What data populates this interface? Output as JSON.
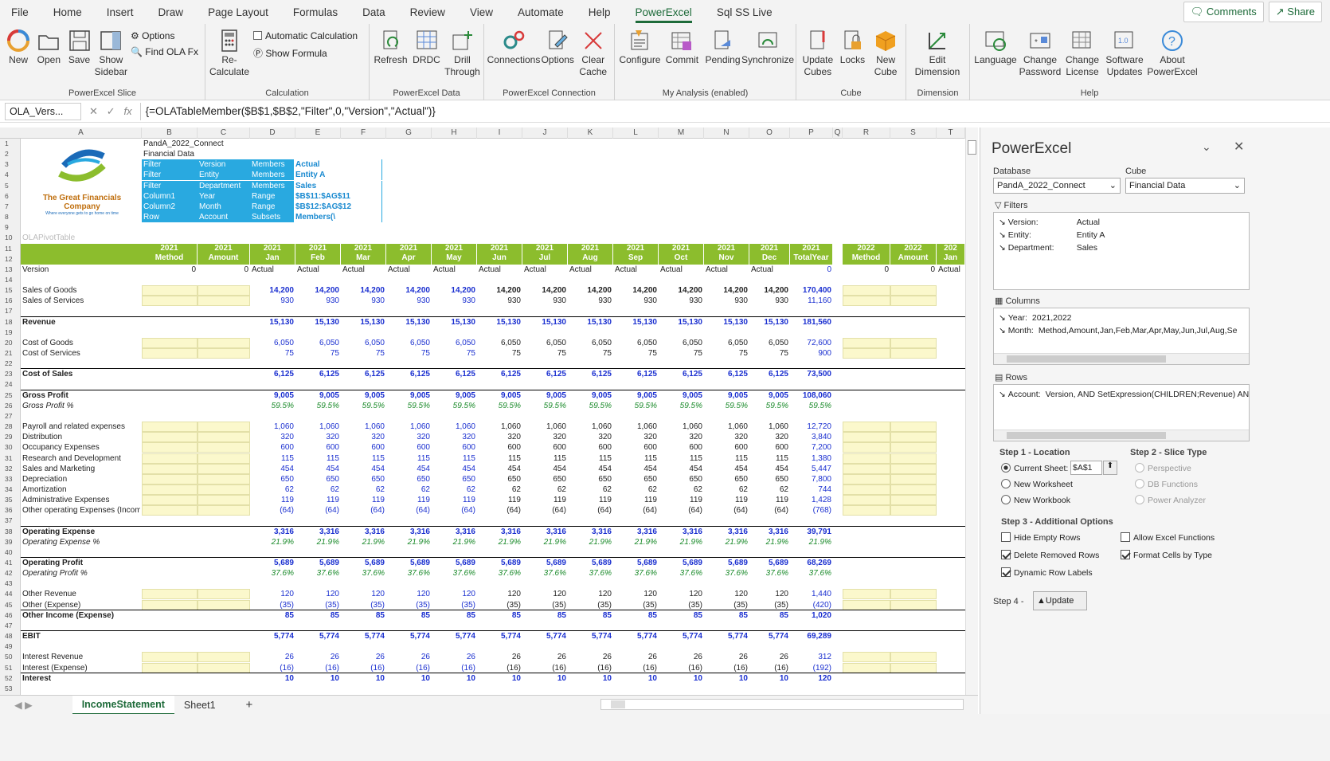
{
  "menu": {
    "items": [
      "File",
      "Home",
      "Insert",
      "Draw",
      "Page Layout",
      "Formulas",
      "Data",
      "Review",
      "View",
      "Automate",
      "Help",
      "PowerExcel",
      "Sql SS Live"
    ],
    "active": "PowerExcel",
    "comments": "Comments",
    "share": "Share"
  },
  "ribbon": {
    "slice": {
      "label": "PowerExcel Slice",
      "new": "New",
      "open": "Open",
      "save": "Save",
      "show_sidebar": "Show Sidebar",
      "options": "Options",
      "find": "Find OLA Fx"
    },
    "calc": {
      "label": "Calculation",
      "recalc": "Re-Calculate",
      "auto": "Automatic Calculation",
      "show_formula": "Show Formula"
    },
    "data": {
      "label": "PowerExcel Data",
      "refresh": "Refresh",
      "drdc": "DRDC",
      "drill": "Drill Through"
    },
    "conn": {
      "label": "PowerExcel Connection",
      "connections": "Connections",
      "options": "Options",
      "clear": "Clear Cache"
    },
    "analysis": {
      "label": "My Analysis (enabled)",
      "configure": "Configure",
      "commit": "Commit",
      "pending": "Pending",
      "sync": "Synchronize"
    },
    "cube": {
      "label": "Cube",
      "update": "Update Cubes",
      "locks": "Locks",
      "new": "New Cube"
    },
    "dimension": {
      "label": "Dimension",
      "edit": "Edit Dimension"
    },
    "help": {
      "label": "Help",
      "language": "Language",
      "change_pw": "Change Password",
      "change_lic": "Change License",
      "sw_updates": "Software Updates",
      "about": "About PowerExcel"
    }
  },
  "formula_bar": {
    "name_box": "OLA_Vers...",
    "fx": "fx",
    "formula": "{=OLATableMember($B$1,$B$2,\"Filter\",0,\"Version\",\"Actual\")}"
  },
  "columns": [
    "A",
    "B",
    "C",
    "D",
    "E",
    "F",
    "G",
    "H",
    "I",
    "J",
    "K",
    "L",
    "M",
    "N",
    "O",
    "P",
    "Q",
    "R",
    "S",
    "T"
  ],
  "logo": {
    "line1": "The Great Financials",
    "line2": "Company",
    "tagline": "Where everyone gets to go home on time"
  },
  "header_block": {
    "b1": "PandA_2022_Connect",
    "b2": "Financial Data",
    "rows": [
      {
        "c1": "Filter",
        "c2": "Version",
        "c3": "Members",
        "c4": "Actual"
      },
      {
        "c1": "Filter",
        "c2": "Entity",
        "c3": "Members",
        "c4": "Entity A"
      },
      {
        "c1": "Filter",
        "c2": "Department",
        "c3": "Members",
        "c4": "Sales"
      },
      {
        "c1": "Column1",
        "c2": "Year",
        "c3": "Range",
        "c4": "$B$11:$AG$11"
      },
      {
        "c1": "Column2",
        "c2": "Month",
        "c3": "Range",
        "c4": "$B$12:$AG$12"
      },
      {
        "c1": "Row",
        "c2": "Account",
        "c3": "Subsets",
        "c4": "Members(\\"
      }
    ],
    "pivot_label": "OLAPivotTable"
  },
  "col_headers": [
    {
      "y": "2021",
      "m": "Method"
    },
    {
      "y": "2021",
      "m": "Amount"
    },
    {
      "y": "2021",
      "m": "Jan"
    },
    {
      "y": "2021",
      "m": "Feb"
    },
    {
      "y": "2021",
      "m": "Mar"
    },
    {
      "y": "2021",
      "m": "Apr"
    },
    {
      "y": "2021",
      "m": "May"
    },
    {
      "y": "2021",
      "m": "Jun"
    },
    {
      "y": "2021",
      "m": "Jul"
    },
    {
      "y": "2021",
      "m": "Aug"
    },
    {
      "y": "2021",
      "m": "Sep"
    },
    {
      "y": "2021",
      "m": "Oct"
    },
    {
      "y": "2021",
      "m": "Nov"
    },
    {
      "y": "2021",
      "m": "Dec"
    },
    {
      "y": "2021",
      "m": "TotalYear"
    },
    {
      "y": "2022",
      "m": "Method"
    },
    {
      "y": "2022",
      "m": "Amount"
    },
    {
      "y": "202",
      "m": "Jan"
    }
  ],
  "version_row": {
    "label": "Version",
    "b": "0",
    "c": "0",
    "month": "Actual",
    "total": "0",
    "r": "0",
    "s": "0",
    "t": "Actual"
  },
  "rows": [
    {
      "r": 15,
      "label": "Sales of Goods",
      "v": "14,200",
      "t": "170,400",
      "style": "bold",
      "yellow": true
    },
    {
      "r": 16,
      "label": "Sales of Services",
      "v": "930",
      "t": "11,160",
      "style": "",
      "yellow": true
    },
    {
      "r": 18,
      "label": "Revenue",
      "v": "15,130",
      "t": "181,560",
      "style": "total"
    },
    {
      "r": 20,
      "label": "Cost of Goods",
      "v": "6,050",
      "t": "72,600",
      "style": "",
      "yellow": true
    },
    {
      "r": 21,
      "label": "Cost of Services",
      "v": "75",
      "t": "900",
      "style": "",
      "yellow": true
    },
    {
      "r": 23,
      "label": "Cost of Sales",
      "v": "6,125",
      "t": "73,500",
      "style": "total"
    },
    {
      "r": 25,
      "label": "Gross Profit",
      "v": "9,005",
      "t": "108,060",
      "style": "total"
    },
    {
      "r": 26,
      "label": "Gross Profit %",
      "v": "59.5%",
      "t": "59.5%",
      "style": "pct"
    },
    {
      "r": 28,
      "label": "Payroll and related expenses",
      "v": "1,060",
      "t": "12,720",
      "style": "",
      "yellow": true
    },
    {
      "r": 29,
      "label": "Distribution",
      "v": "320",
      "t": "3,840",
      "style": "",
      "yellow": true
    },
    {
      "r": 30,
      "label": "Occupancy Expenses",
      "v": "600",
      "t": "7,200",
      "style": "",
      "yellow": true
    },
    {
      "r": 31,
      "label": "Research and Development",
      "v": "115",
      "t": "1,380",
      "style": "",
      "yellow": true
    },
    {
      "r": 32,
      "label": "Sales and Marketing",
      "v": "454",
      "t": "5,447",
      "style": "",
      "yellow": true
    },
    {
      "r": 33,
      "label": "Depreciation",
      "v": "650",
      "t": "7,800",
      "style": "",
      "yellow": true
    },
    {
      "r": 34,
      "label": "Amortization",
      "v": "62",
      "t": "744",
      "style": "",
      "yellow": true
    },
    {
      "r": 35,
      "label": "Administrative Expenses",
      "v": "119",
      "t": "1,428",
      "style": "",
      "yellow": true
    },
    {
      "r": 36,
      "label": "Other operating Expenses (Income",
      "v": "(64)",
      "t": "(768)",
      "style": "",
      "yellow": true
    },
    {
      "r": 38,
      "label": "Operating Expense",
      "v": "3,316",
      "t": "39,791",
      "style": "total"
    },
    {
      "r": 39,
      "label": "Operating Expense %",
      "v": "21.9%",
      "t": "21.9%",
      "style": "pct"
    },
    {
      "r": 41,
      "label": "Operating Profit",
      "v": "5,689",
      "t": "68,269",
      "style": "total"
    },
    {
      "r": 42,
      "label": "Operating Profit %",
      "v": "37.6%",
      "t": "37.6%",
      "style": "pct"
    },
    {
      "r": 44,
      "label": "Other Revenue",
      "v": "120",
      "t": "1,440",
      "style": "",
      "yellow": true
    },
    {
      "r": 45,
      "label": "Other (Expense)",
      "v": "(35)",
      "t": "(420)",
      "style": "",
      "yellow": true
    },
    {
      "r": 46,
      "label": "Other Income (Expense)",
      "v": "85",
      "t": "1,020",
      "style": "total"
    },
    {
      "r": 48,
      "label": "EBIT",
      "v": "5,774",
      "t": "69,289",
      "style": "total"
    },
    {
      "r": 50,
      "label": "Interest Revenue",
      "v": "26",
      "t": "312",
      "style": "",
      "yellow": true
    },
    {
      "r": 51,
      "label": "Interest (Expense)",
      "v": "(16)",
      "t": "(192)",
      "style": "",
      "yellow": true
    },
    {
      "r": 52,
      "label": "Interest",
      "v": "10",
      "t": "120",
      "style": "total"
    }
  ],
  "tabs": {
    "active": "IncomeStatement",
    "other": "Sheet1",
    "add": "+"
  },
  "panel": {
    "title": "PowerExcel",
    "database_label": "Database",
    "database": "PandA_2022_Connect",
    "cube_label": "Cube",
    "cube": "Financial Data",
    "filters_label": "Filters",
    "filters": [
      {
        "k": "Version:",
        "v": "Actual"
      },
      {
        "k": "Entity:",
        "v": "Entity A"
      },
      {
        "k": "Department:",
        "v": "Sales"
      }
    ],
    "columns_label": "Columns",
    "columns": [
      {
        "k": "Year:",
        "v": "2021,2022"
      },
      {
        "k": "Month:",
        "v": "Method,Amount,Jan,Feb,Mar,Apr,May,Jun,Jul,Aug,Se"
      }
    ],
    "rows_label": "Rows",
    "rows": [
      {
        "k": "Account:",
        "v": "Version,  AND SetExpression(CHILDREN;Revenue) AN"
      }
    ],
    "step1": "Step 1 - Location",
    "current_sheet": "Current Sheet:",
    "location": "$A$1",
    "new_ws": "New Worksheet",
    "new_wb": "New Workbook",
    "step2": "Step 2 - Slice Type",
    "perspective": "Perspective",
    "db_functions": "DB Functions",
    "power_analyzer": "Power Analyzer",
    "step3": "Step 3 - Additional Options",
    "hide_empty": "Hide Empty Rows",
    "allow_excel": "Allow Excel Functions",
    "delete_removed": "Delete Removed Rows",
    "format_cells": "Format Cells by Type",
    "dynamic_labels": "Dynamic Row Labels",
    "step4": "Step 4 -",
    "update": "Update"
  },
  "colors": {
    "accent": "#1e6b3a",
    "header_green": "#8cbd2d",
    "value_blue": "#1a2fd0",
    "meta_blue": "#29a9e0",
    "input_yellow": "#fbf8cc"
  }
}
